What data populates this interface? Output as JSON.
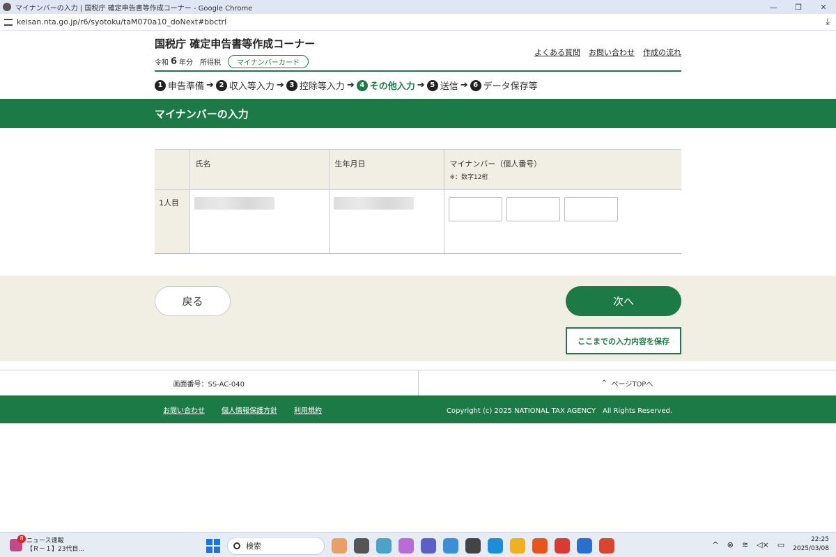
{
  "browser": {
    "window_title": "マイナンバーの入力 | 国税庁 確定申告書等作成コーナー - Google Chrome",
    "url": "keisan.nta.go.jp/r6/syotoku/taM070a10_doNext#bbctrl",
    "minimize": "—",
    "restore": "❐",
    "close": "✕",
    "download": "⤓"
  },
  "header": {
    "site_title": "国税庁 確定申告書等作成コーナー",
    "era": "令和",
    "year": "6",
    "year_suffix": "年分",
    "tax_type": "所得税",
    "method_pill": "マイナンバーカード",
    "links": [
      "よくある質問",
      "お問い合わせ",
      "作成の流れ"
    ]
  },
  "steps": [
    {
      "num": "1",
      "label": "申告準備",
      "active": false
    },
    {
      "num": "2",
      "label": "収入等入力",
      "active": false
    },
    {
      "num": "3",
      "label": "控除等入力",
      "active": false
    },
    {
      "num": "4",
      "label": "その他入力",
      "active": true
    },
    {
      "num": "5",
      "label": "送信",
      "active": false
    },
    {
      "num": "6",
      "label": "データ保存等",
      "active": false
    }
  ],
  "step_arrow": "➔",
  "page_heading": "マイナンバーの入力",
  "table": {
    "headers": {
      "row": "",
      "name": "氏名",
      "birthdate": "生年月日",
      "mynumber": "マイナンバー（個人番号）",
      "mynumber_note": "※：数字12桁"
    },
    "rows": [
      {
        "label": "1人目",
        "mynumber_values": [
          "",
          "",
          ""
        ]
      }
    ]
  },
  "buttons": {
    "back": "戻る",
    "next": "次へ",
    "save": "ここまでの入力内容を保存"
  },
  "footer": {
    "screen_id": "画面番号：SS-AC-040",
    "page_top": "ページTOPへ",
    "page_top_icon": "^",
    "links": [
      "お問い合わせ",
      "個人情報保護方針",
      "利用規約"
    ],
    "copyright": "Copyright (c) 2025 NATIONAL TAX AGENCY　All Rights Reserved."
  },
  "taskbar": {
    "news_badge": "8",
    "news_title": "ニュース速報",
    "news_sub": "【Ｒ－１】23代目...",
    "search_placeholder": "検索",
    "time": "22:25",
    "date": "2025/03/08"
  },
  "colors": {
    "brand_green": "#1b7a45",
    "table_header_bg": "#f1eee3"
  }
}
